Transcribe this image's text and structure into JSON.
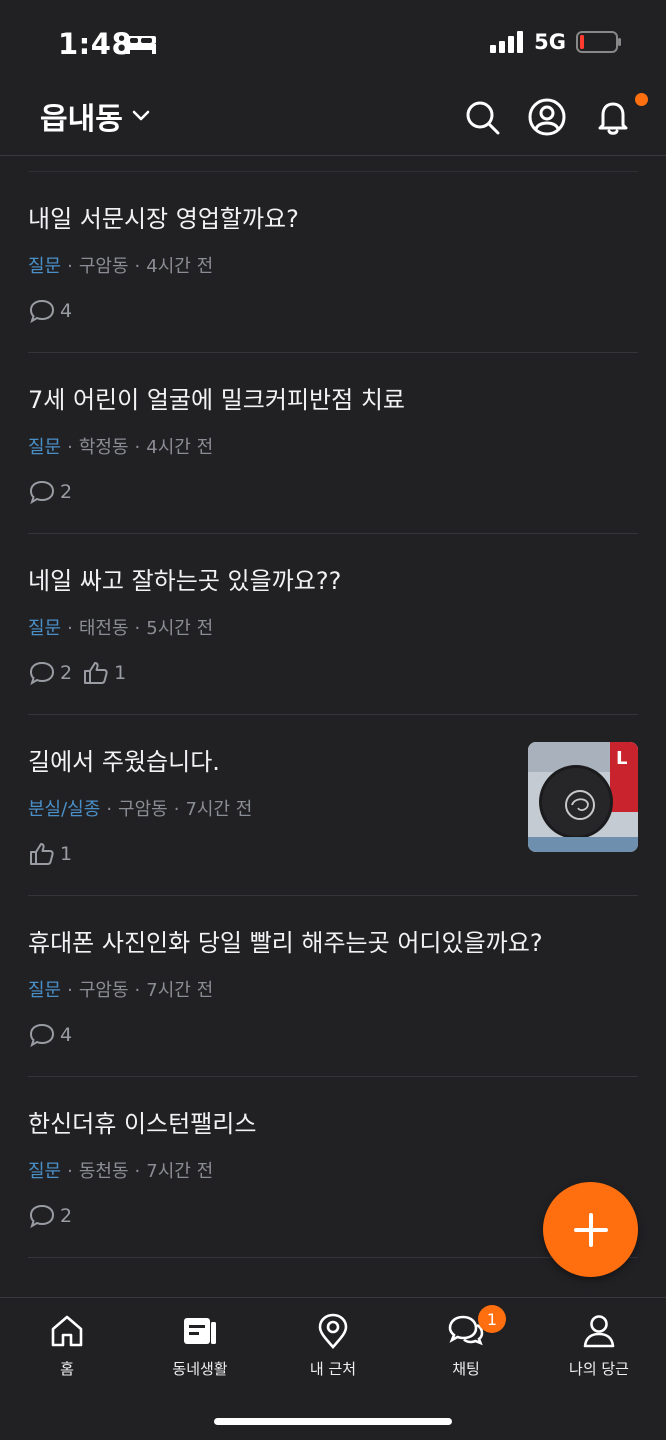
{
  "status_bar": {
    "time": "1:48",
    "network": "5G"
  },
  "header": {
    "location": "읍내동"
  },
  "posts": [
    {
      "title": "내일 서문시장 영업할까요?",
      "category": "질문",
      "neighborhood": "구암동",
      "time": "4시간 전",
      "comments": "4",
      "likes": ""
    },
    {
      "title": "7세 어린이 얼굴에 밀크커피반점 치료",
      "category": "질문",
      "neighborhood": "학정동",
      "time": "4시간 전",
      "comments": "2",
      "likes": ""
    },
    {
      "title": "네일 싸고 잘하는곳 있을까요??",
      "category": "질문",
      "neighborhood": "태전동",
      "time": "5시간 전",
      "comments": "2",
      "likes": "1"
    },
    {
      "title": "길에서 주웠습니다.",
      "category": "분실/실종",
      "neighborhood": "구암동",
      "time": "7시간 전",
      "comments": "",
      "likes": "1",
      "has_image": true
    },
    {
      "title": "휴대폰 사진인화 당일 빨리 해주는곳 어디있을까요?",
      "category": "질문",
      "neighborhood": "구암동",
      "time": "7시간 전",
      "comments": "4",
      "likes": ""
    },
    {
      "title": "한신더휴 이스턴팰리스",
      "category": "질문",
      "neighborhood": "동천동",
      "time": "7시간 전",
      "comments": "2",
      "likes": ""
    }
  ],
  "nav": {
    "items": [
      {
        "label": "홈",
        "icon": "home-icon"
      },
      {
        "label": "동네생활",
        "icon": "community-icon"
      },
      {
        "label": "내 근처",
        "icon": "location-pin-icon"
      },
      {
        "label": "채팅",
        "icon": "chat-icon",
        "badge": "1"
      },
      {
        "label": "나의 당근",
        "icon": "person-icon"
      }
    ]
  },
  "colors": {
    "accent": "#ff6f0f",
    "background": "#212124",
    "category": "#4a90c8"
  }
}
